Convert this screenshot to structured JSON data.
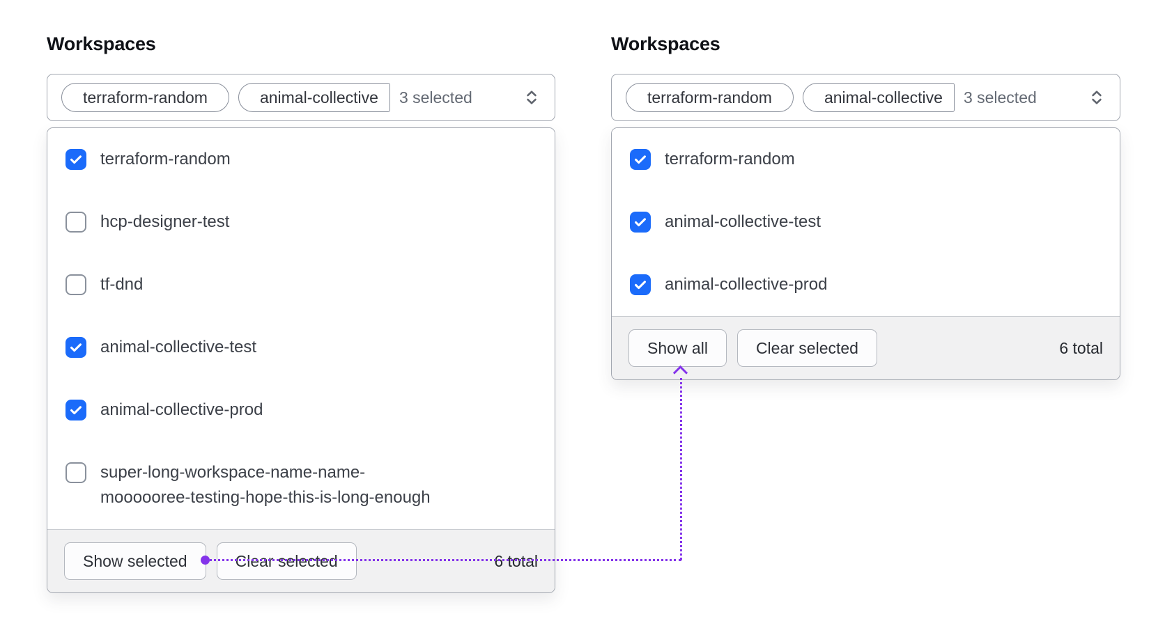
{
  "colors": {
    "checkbox_blue": "#1B6BFA",
    "annotation_purple": "#8434EA",
    "footer_background": "#F1F1F2",
    "panel_border": "#A2A7B0"
  },
  "left_panel": {
    "label": "Workspaces",
    "trigger": {
      "tags": [
        "terraform-random",
        "animal-collective"
      ],
      "count_text": "3 selected",
      "chevron_icon": "chevrons-up-down-icon"
    },
    "options": [
      {
        "label": "terraform-random",
        "checked": true
      },
      {
        "label": "hcp-designer-test",
        "checked": false
      },
      {
        "label": "tf-dnd",
        "checked": false
      },
      {
        "label": "animal-collective-test",
        "checked": true
      },
      {
        "label": "animal-collective-prod",
        "checked": true
      },
      {
        "label": "super-long-workspace-name-name-\nmoooooree-testing-hope-this-is-long-enough",
        "checked": false
      }
    ],
    "footer": {
      "show_button": "Show selected",
      "clear_button": "Clear selected",
      "total": "6 total"
    }
  },
  "right_panel": {
    "label": "Workspaces",
    "trigger": {
      "tags": [
        "terraform-random",
        "animal-collective"
      ],
      "count_text": "3 selected",
      "chevron_icon": "chevrons-up-down-icon"
    },
    "options": [
      {
        "label": "terraform-random",
        "checked": true
      },
      {
        "label": "animal-collective-test",
        "checked": true
      },
      {
        "label": "animal-collective-prod",
        "checked": true
      }
    ],
    "footer": {
      "show_button": "Show all",
      "clear_button": "Clear selected",
      "total": "6 total"
    }
  },
  "annotation": {
    "type": "dotted-connector",
    "color": "#8434EA",
    "from": "show-selected-button",
    "to": "show-all-button"
  }
}
